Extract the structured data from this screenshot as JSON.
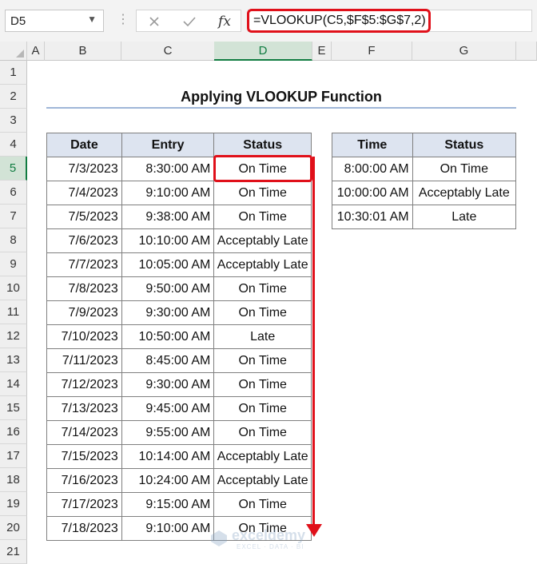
{
  "formula_bar": {
    "name_box": "D5",
    "formula": "=VLOOKUP(C5,$F$5:$G$7,2)",
    "fx_label": "fx",
    "cancel_icon": "close-icon",
    "enter_icon": "check-icon"
  },
  "columns": [
    "A",
    "B",
    "C",
    "D",
    "E",
    "F",
    "G"
  ],
  "active_column": "D",
  "rows": [
    "1",
    "2",
    "3",
    "4",
    "5",
    "6",
    "7",
    "8",
    "9",
    "10",
    "11",
    "12",
    "13",
    "14",
    "15",
    "16",
    "17",
    "18",
    "19",
    "20",
    "21"
  ],
  "active_row": "5",
  "title": "Applying VLOOKUP Function",
  "main_table": {
    "headers": [
      "Date",
      "Entry",
      "Status"
    ],
    "rows": [
      [
        "7/3/2023",
        "8:30:00 AM",
        "On Time"
      ],
      [
        "7/4/2023",
        "9:10:00 AM",
        "On Time"
      ],
      [
        "7/5/2023",
        "9:38:00 AM",
        "On Time"
      ],
      [
        "7/6/2023",
        "10:10:00 AM",
        "Acceptably Late"
      ],
      [
        "7/7/2023",
        "10:05:00 AM",
        "Acceptably Late"
      ],
      [
        "7/8/2023",
        "9:50:00 AM",
        "On Time"
      ],
      [
        "7/9/2023",
        "9:30:00 AM",
        "On Time"
      ],
      [
        "7/10/2023",
        "10:50:00 AM",
        "Late"
      ],
      [
        "7/11/2023",
        "8:45:00 AM",
        "On Time"
      ],
      [
        "7/12/2023",
        "9:30:00 AM",
        "On Time"
      ],
      [
        "7/13/2023",
        "9:45:00 AM",
        "On Time"
      ],
      [
        "7/14/2023",
        "9:55:00 AM",
        "On Time"
      ],
      [
        "7/15/2023",
        "10:14:00 AM",
        "Acceptably Late"
      ],
      [
        "7/16/2023",
        "10:24:00 AM",
        "Acceptably Late"
      ],
      [
        "7/17/2023",
        "9:15:00 AM",
        "On Time"
      ],
      [
        "7/18/2023",
        "9:10:00 AM",
        "On Time"
      ]
    ]
  },
  "lookup_table": {
    "headers": [
      "Time",
      "Status"
    ],
    "rows": [
      [
        "8:00:00 AM",
        "On Time"
      ],
      [
        "10:00:00 AM",
        "Acceptably Late"
      ],
      [
        "10:30:01 AM",
        "Late"
      ]
    ]
  },
  "watermark": {
    "name": "exceldemy",
    "tagline": "EXCEL · DATA · BI"
  },
  "colors": {
    "highlight": "#e0101a",
    "header_fill": "#dde4f0",
    "active_header": "#107c41"
  }
}
